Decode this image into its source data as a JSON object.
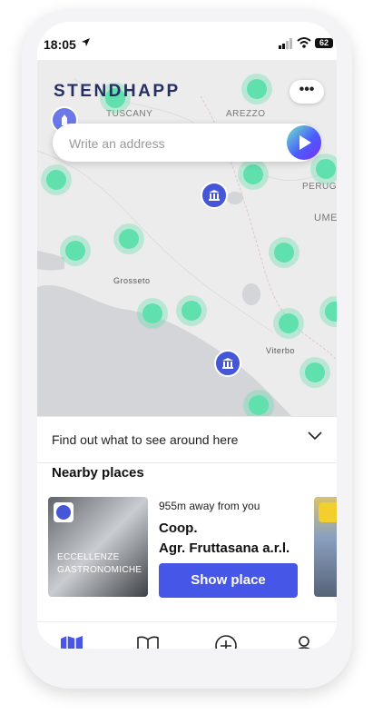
{
  "status_bar": {
    "time": "18:05",
    "battery": "62"
  },
  "map": {
    "labels": {
      "tuscany": "TUSCANY",
      "arezzo": "AREZZO",
      "perugia": "PERUGI",
      "umbria": "UME",
      "grosseto": "Grosseto",
      "viterbo": "Viterbo"
    }
  },
  "header": {
    "logo_text": "STENDHAPP",
    "more_label": "•••"
  },
  "search": {
    "placeholder": "Write an address"
  },
  "find_out": {
    "label": "Find out what to see around here"
  },
  "nearby": {
    "title": "Nearby places",
    "card": {
      "category": "ECCELLENZE\nGASTRONOMICHE",
      "distance": "955m away from you",
      "name": "Coop.\nAgr. Fruttasana a.r.l.",
      "button_label": "Show place"
    }
  },
  "tabbar": {
    "items": [
      "map",
      "guide",
      "add",
      "profile"
    ]
  },
  "colors": {
    "accent": "#4656e6",
    "cluster": "#5fe0ad",
    "pin": "#4656d8"
  }
}
